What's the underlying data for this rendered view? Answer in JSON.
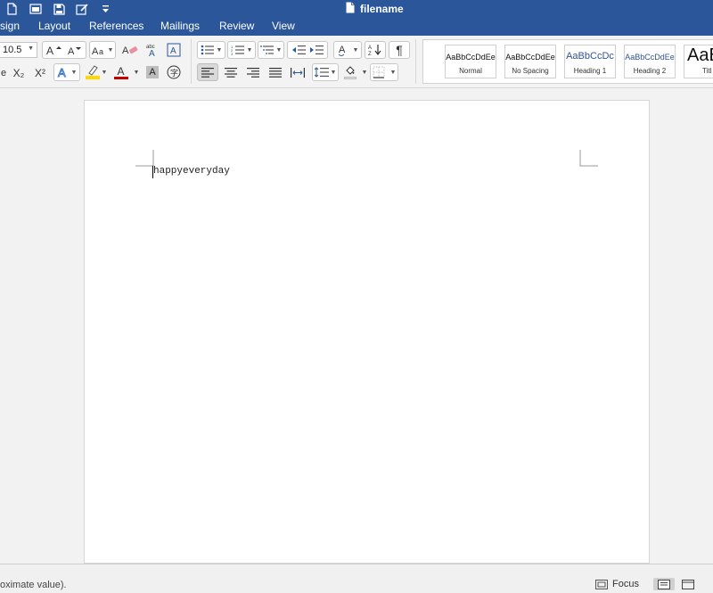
{
  "title_bar": {
    "document_name": "filename",
    "tabs": [
      "sign",
      "Layout",
      "References",
      "Mailings",
      "Review",
      "View"
    ],
    "accent_color": "#2b579a"
  },
  "quick_access": [
    "document-icon",
    "window-icon",
    "save-icon",
    "edit-icon",
    "customize-icon"
  ],
  "ribbon": {
    "font_size": "10.5",
    "subscript_label": "X₂",
    "superscript_label": "X²",
    "highlight_color": "#ffd800",
    "font_color": "#c00000",
    "styles": [
      {
        "sample": "AaBbCcDdEe",
        "label": "Normal"
      },
      {
        "sample": "AaBbCcDdEe",
        "label": "No Spacing"
      },
      {
        "sample": "AaBbCcDc",
        "label": "Heading 1"
      },
      {
        "sample": "AaBbCcDdEe",
        "label": "Heading 2"
      },
      {
        "sample": "AaB",
        "label": "Titl"
      }
    ]
  },
  "document": {
    "body_text": "happyeveryday"
  },
  "status_bar": {
    "message": "oximate value).",
    "focus_label": "Focus"
  }
}
